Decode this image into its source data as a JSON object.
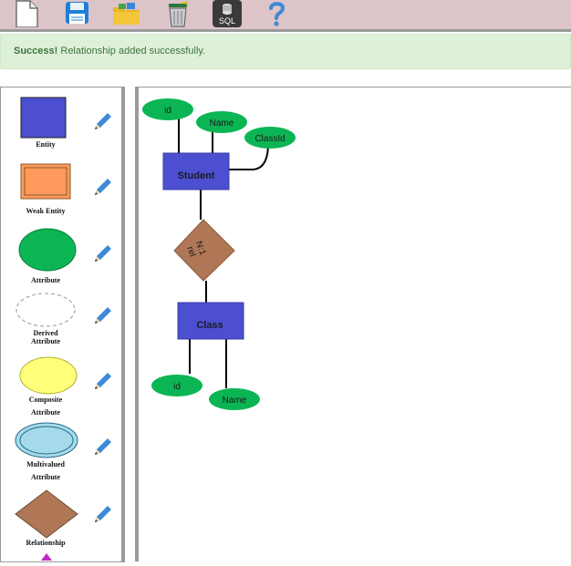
{
  "toolbar": {
    "buttons": [
      {
        "name": "new-document-icon"
      },
      {
        "name": "save-icon"
      },
      {
        "name": "open-folder-icon"
      },
      {
        "name": "delete-bin-icon"
      },
      {
        "name": "sql-database-icon",
        "label": "SQL"
      },
      {
        "name": "help-icon"
      }
    ]
  },
  "alert": {
    "strong": "Success!",
    "message": "Relationship added successfully."
  },
  "palette": {
    "items": [
      {
        "label": "Entity"
      },
      {
        "label": "Weak Entity"
      },
      {
        "label": "Attribute"
      },
      {
        "label_line1": "Derived",
        "label_line2": "Attribute"
      },
      {
        "label_line1": "Composite",
        "label_line2": "Attribute"
      },
      {
        "label_line1": "Multivalued",
        "label_line2": "Attribute"
      },
      {
        "label": "Relationship"
      }
    ]
  },
  "diagram": {
    "student": {
      "entity": "Student",
      "attr_id": "id",
      "attr_name": "Name",
      "attr_classid": "ClassId"
    },
    "relationship": {
      "name": "rel",
      "cardinality": "N:1"
    },
    "class": {
      "entity": "Class",
      "attr_id": "id",
      "attr_name": "Name"
    }
  },
  "colors": {
    "entity": "#4b4fd0",
    "attribute": "#0bb554",
    "relationship": "#b07756",
    "weak_entity": "#ff9a5c",
    "composite": "#ffff7a",
    "multivalued": "#a4daea",
    "alert_bg": "#dff0d8",
    "alert_text": "#3c763d",
    "toolbar_bg": "#dcc4c8"
  }
}
